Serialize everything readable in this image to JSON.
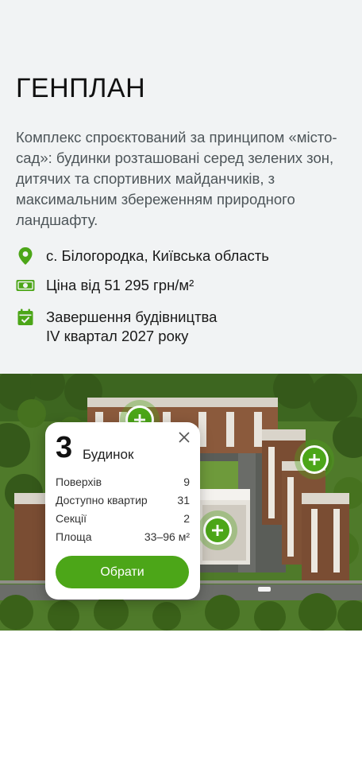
{
  "header": {
    "title": "ГЕНПЛАН",
    "intro": "Комплекс спроєктований за принципом «місто-сад»: будинки розташовані серед зелених зон, дитячих та спортивних майданчиків, з максимальним збереженням природного ландшафту."
  },
  "features": {
    "location": "с. Білогородка, Київська область",
    "price": "Ціна від 51 295 грн/м²",
    "completion_line1": "Завершення будівництва",
    "completion_line2": "IV квартал 2027 року"
  },
  "popup": {
    "number": "3",
    "label": "Будинок",
    "rows": [
      {
        "label": "Поверхів",
        "value": "9"
      },
      {
        "label": "Доступно квартир",
        "value": "31"
      },
      {
        "label": "Секції",
        "value": "2"
      },
      {
        "label": "Площа",
        "value": "33–96 м²"
      }
    ],
    "button": "Обрати"
  },
  "colors": {
    "accent": "#4ca618",
    "top_bg": "#f1f3f4",
    "intro_text": "#4d5559"
  },
  "icons": [
    "location-pin-icon",
    "money-icon",
    "calendar-check-icon",
    "close-icon",
    "plus-icon"
  ]
}
